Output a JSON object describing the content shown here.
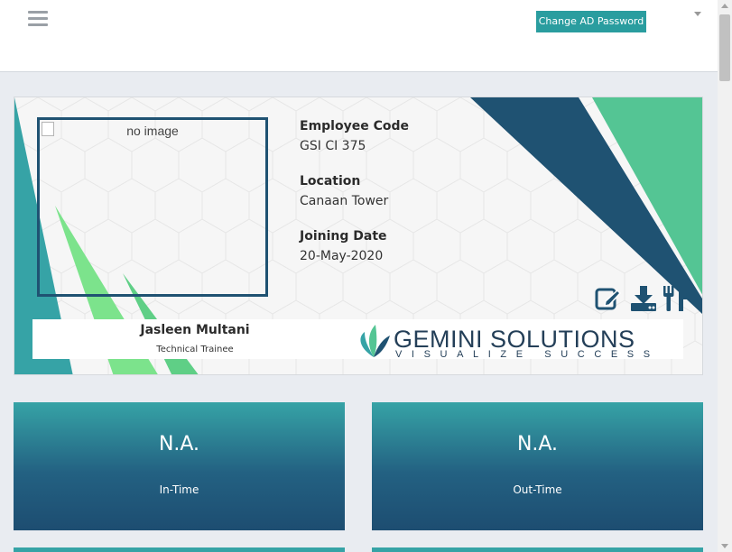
{
  "header": {
    "change_password_label": "Change AD Password"
  },
  "profile": {
    "photo_alt": "no image",
    "fields": [
      {
        "label": "Employee Code",
        "value": "GSI CI 375"
      },
      {
        "label": "Location",
        "value": "Canaan Tower"
      },
      {
        "label": "Joining Date",
        "value": "20-May-2020"
      }
    ],
    "name": "Jasleen Multani",
    "role": "Technical Trainee",
    "actions": [
      "edit-icon",
      "download-icon",
      "meal-icon"
    ]
  },
  "logo": {
    "title": "GEMINI SOLUTIONS",
    "tagline": "VISUALIZE SUCCESS"
  },
  "tiles": [
    {
      "value": "N.A.",
      "label": "In-Time"
    },
    {
      "value": "N.A.",
      "label": "Out-Time"
    }
  ],
  "colors": {
    "accent_teal": "#2a9d9f",
    "navy": "#1f5272",
    "green": "#54c594",
    "light_green": "#7ce38c"
  }
}
